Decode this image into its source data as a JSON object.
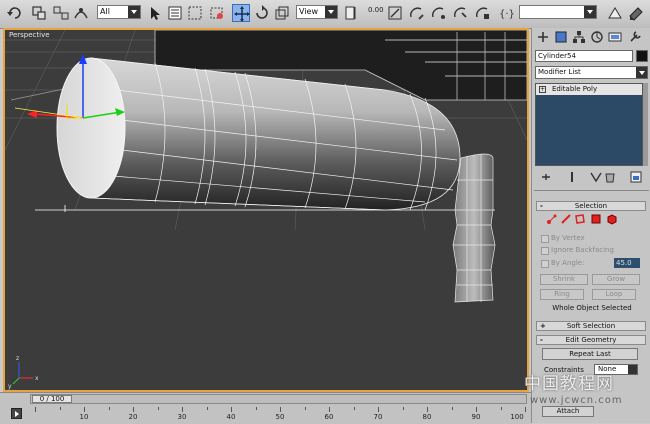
{
  "toolbar": {
    "selection_filter": "All",
    "reference_coord": "View",
    "spinner_snap": "0.00",
    "named_selection": "",
    "icons": [
      "undo-icon",
      "select-link-icon",
      "unlink-icon",
      "bind-spacewarp-icon",
      "select-object-icon",
      "select-by-name-icon",
      "rect-region-icon",
      "window-crossing-icon",
      "select-move-icon",
      "select-rotate-icon",
      "select-scale-icon",
      "pivot-center-icon",
      "manipulate-icon",
      "snap-icon",
      "angle-snap-icon",
      "percent-snap-icon",
      "mirror-icon",
      "align-icon",
      "layer-icon",
      "curve-editor-icon",
      "schematic-icon",
      "material-editor-icon",
      "render-setup-icon",
      "render-icon"
    ]
  },
  "viewport": {
    "label": "Perspective",
    "border_color": "#e8a33c",
    "axes": {
      "x": "x",
      "y": "y",
      "z": "z"
    }
  },
  "panel": {
    "object_name": "Cylinder54",
    "object_color": "#111111",
    "modifier_list": "Modifier List",
    "stack_items": [
      {
        "label": "Editable Poly",
        "sign": "+"
      }
    ],
    "selection": {
      "title": "Selection",
      "sign": "-",
      "by_vertex": "By Vertex",
      "ignore_backfacing": "Ignore Backfacing",
      "by_angle": "By Angle:",
      "angle_value": "45.0",
      "shrink": "Shrink",
      "grow": "Grow",
      "ring": "Ring",
      "loop": "Loop",
      "status": "Whole Object Selected"
    },
    "soft_selection": {
      "title": "Soft Selection",
      "sign": "+"
    },
    "edit_geometry": {
      "title": "Edit Geometry",
      "sign": "-",
      "repeat_last": "Repeat Last",
      "constraints_label": "Constraints",
      "constraints_value": "None",
      "attach": "Attach"
    }
  },
  "timeline": {
    "frame_display": "0 / 100",
    "labels": [
      "10",
      "20",
      "30",
      "40",
      "50",
      "60",
      "70",
      "80",
      "90",
      "100"
    ]
  },
  "watermark": {
    "cn": "中国教程网",
    "url": "www.jcwcn.com"
  }
}
